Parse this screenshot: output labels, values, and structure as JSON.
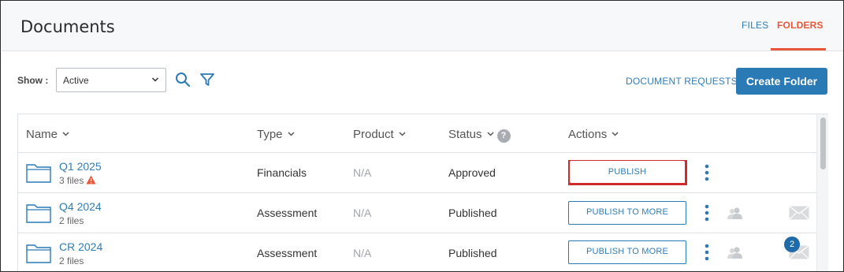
{
  "header": {
    "title": "Documents",
    "tabs": [
      {
        "label": "FILES",
        "active": false
      },
      {
        "label": "FOLDERS",
        "active": true
      }
    ]
  },
  "toolbar": {
    "show_label": "Show :",
    "show_value": "Active",
    "document_requests_label": "DOCUMENT REQUESTS",
    "create_folder_label": "Create Folder",
    "icons": [
      "search-icon",
      "filter-icon"
    ]
  },
  "table": {
    "columns": [
      "Name",
      "Type",
      "Product",
      "Status",
      "Actions"
    ],
    "rows": [
      {
        "name": "Q1 2025",
        "files": "3 files",
        "warning": true,
        "type": "Financials",
        "product": "N/A",
        "status": "Approved",
        "action": "PUBLISH",
        "highlighted": true,
        "badge": null
      },
      {
        "name": "Q4 2024",
        "files": "2 files",
        "warning": false,
        "type": "Assessment",
        "product": "N/A",
        "status": "Published",
        "action": "PUBLISH TO MORE",
        "highlighted": false,
        "badge": null
      },
      {
        "name": "CR 2024",
        "files": "2 files",
        "warning": false,
        "type": "Assessment",
        "product": "N/A",
        "status": "Published",
        "action": "PUBLISH TO MORE",
        "highlighted": false,
        "badge": "2"
      }
    ]
  },
  "colors": {
    "accent": "#2a7ab6",
    "link": "#2f7db5",
    "active_tab": "#e8573a",
    "highlight": "#d02b2b",
    "warning": "#e8573a"
  }
}
